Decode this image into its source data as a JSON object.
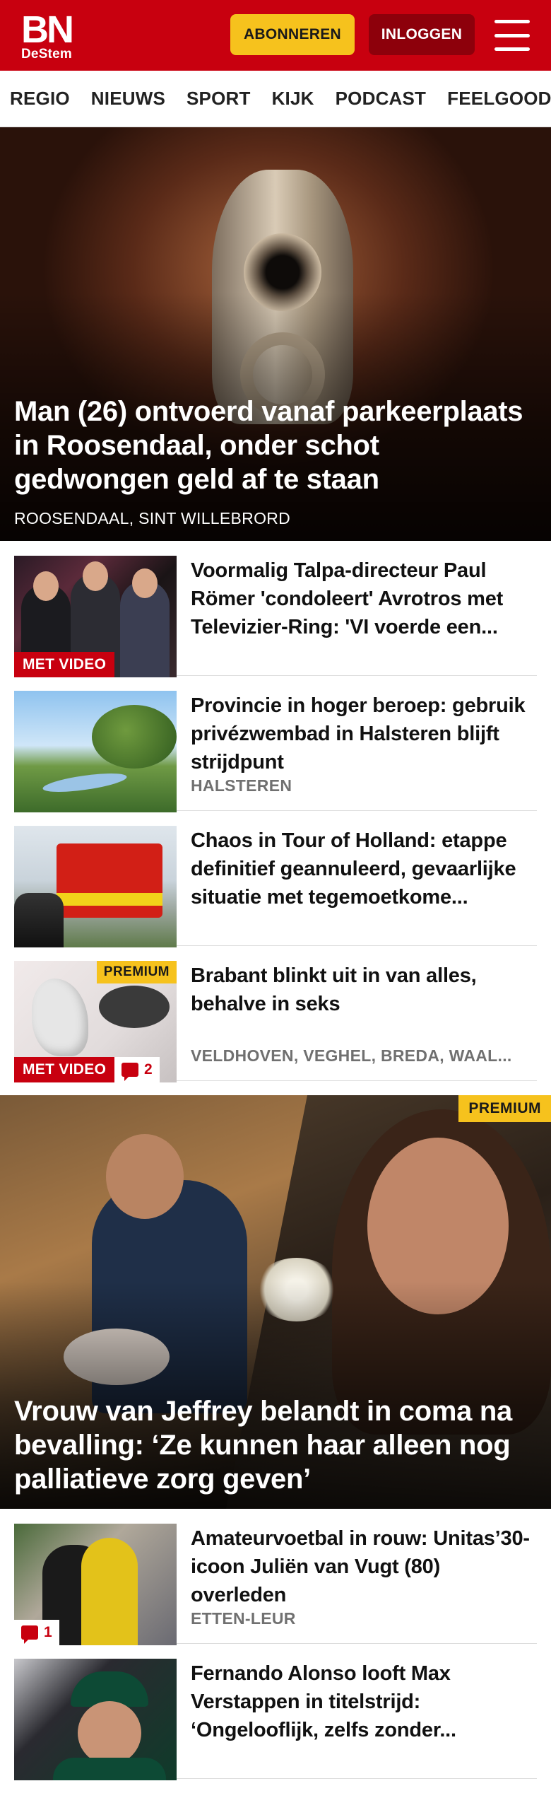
{
  "header": {
    "logo_main": "BN",
    "logo_sub": "DeStem",
    "subscribe_label": "ABONNEREN",
    "login_label": "INLOGGEN",
    "menu_icon": "hamburger-menu-icon",
    "brand_color": "#c8000f",
    "accent_color": "#f6c21d"
  },
  "nav": {
    "items": [
      "REGIO",
      "NIEUWS",
      "SPORT",
      "KIJK",
      "PODCAST",
      "FEELGOOD"
    ]
  },
  "hero": {
    "title": "Man (26) ontvoerd vanaf parkeer­plaats in Roosendaal, onder schot gedwongen geld af te staan",
    "location": "ROOSENDAAL, SINT WILLEBRORD"
  },
  "articles": [
    {
      "title": "Voormalig Talpa-directeur Paul Römer 'condoleert' Avrotros met Televizier-Ring: 'VI voerde een...",
      "location": "",
      "video_badge": "MET VIDEO"
    },
    {
      "title": "Provincie in hoger beroep: gebruik privézwembad in Halsteren blijft strijdpunt",
      "location": "HALSTEREN"
    },
    {
      "title": "Chaos in Tour of Holland: etappe definitief geannuleerd, gevaarlij­ke situatie met tegemoetkome...",
      "location": ""
    },
    {
      "title": "Brabant blinkt uit in van alles, behalve in seks",
      "location": "VELDHOVEN, VEGHEL, BREDA, WAAL...",
      "premium_badge": "PREMIUM",
      "video_badge": "MET VIDEO",
      "comments": "2"
    }
  ],
  "hero2": {
    "title": "Vrouw van Jeffrey belandt in coma na bevalling: ‘Ze kunnen haar alleen nog palliatieve zorg geven’",
    "premium_badge": "PREMIUM"
  },
  "articles2": [
    {
      "title": "Amateurvoetbal in rouw: Uni­tas’30-icoon Juliën van Vugt (80) overleden",
      "location": "ETTEN-LEUR",
      "comments": "1"
    },
    {
      "title": "Fernando Alonso looft Max Verstappen in titelstrijd: ‘Ongelooflijk, zelfs zonder...",
      "location": ""
    }
  ]
}
